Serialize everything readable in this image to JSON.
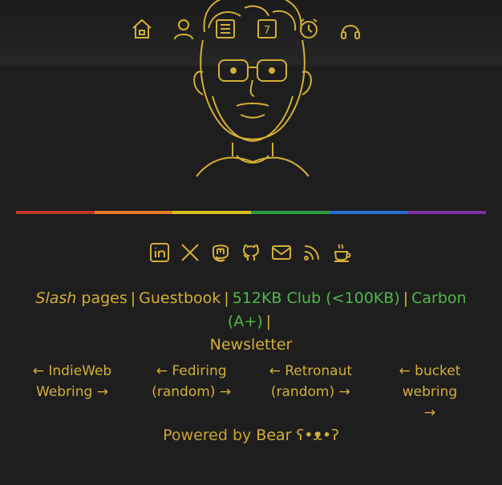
{
  "nav": {
    "items": [
      {
        "icon": "home-icon"
      },
      {
        "icon": "user-icon"
      },
      {
        "icon": "notes-icon"
      },
      {
        "icon": "calendar-icon",
        "label": "7"
      },
      {
        "icon": "clock-icon"
      },
      {
        "icon": "headphones-icon"
      }
    ]
  },
  "rainbow": [
    "#c0392b",
    "#e67e22",
    "#d4c21a",
    "#2e9e43",
    "#2a6fcf",
    "#7a2fa0"
  ],
  "social": [
    {
      "icon": "linkedin-icon"
    },
    {
      "icon": "x-icon"
    },
    {
      "icon": "mastodon-icon"
    },
    {
      "icon": "github-icon"
    },
    {
      "icon": "mail-icon"
    },
    {
      "icon": "rss-icon"
    },
    {
      "icon": "coffee-icon"
    }
  ],
  "links": {
    "slash": "Slash",
    "pages": "pages",
    "guestbook": "Guestbook",
    "club": "512KB Club (<100KB)",
    "carbon": "Carbon (A+)",
    "newsletter": "Newsletter",
    "sep": "|"
  },
  "webrings": [
    {
      "line1": "← IndieWeb",
      "line2": "Webring →"
    },
    {
      "line1": "← Fediring",
      "line2": "(random) →"
    },
    {
      "line1": "← Retronaut",
      "line2": "(random) →"
    },
    {
      "line1": "← bucket webring",
      "line2": "→"
    }
  ],
  "footer": {
    "powered": "Powered by",
    "bear": "Bear ʕ•ᴥ•ʔ"
  },
  "colors": {
    "accent": "#d4af37",
    "link_green": "#50b848",
    "background": "#1e1e1e"
  }
}
